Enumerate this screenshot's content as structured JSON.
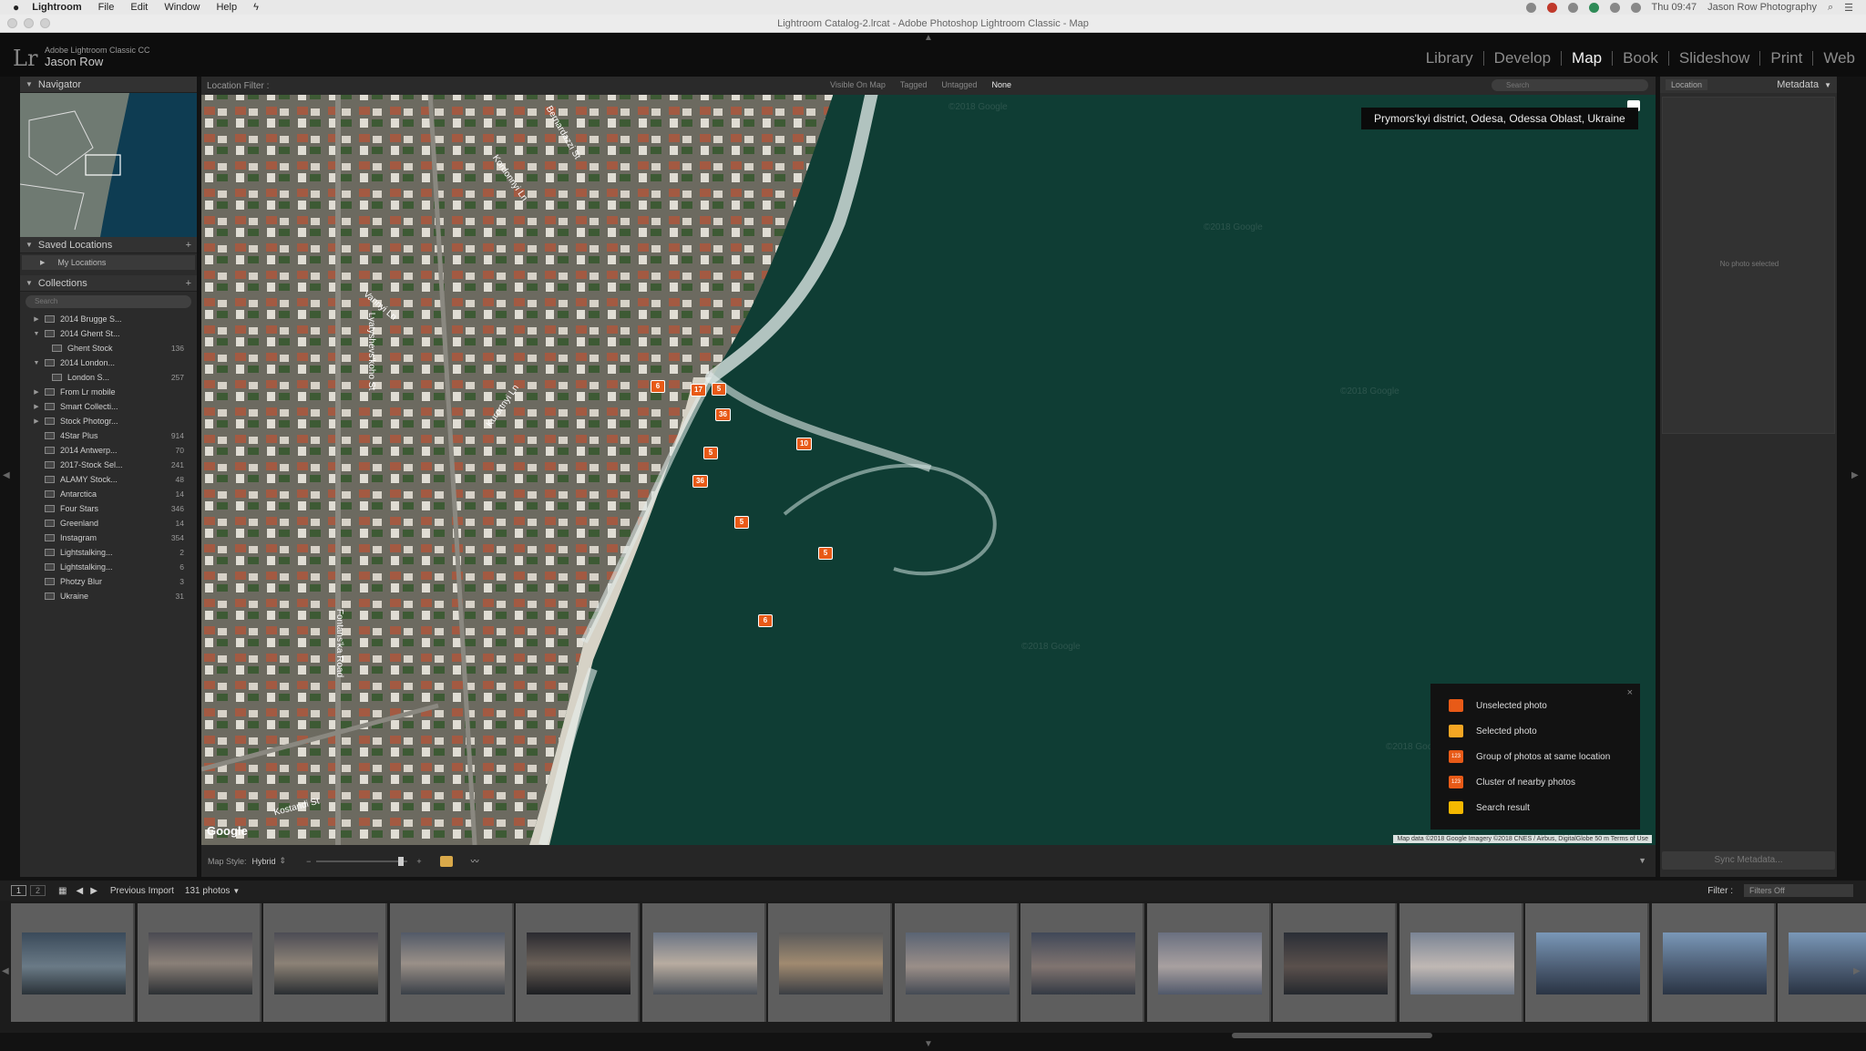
{
  "menubar": {
    "apple": "",
    "app": "Lightroom",
    "items": [
      "File",
      "Edit",
      "Window",
      "Help"
    ],
    "clock": "Thu 09:47",
    "user": "Jason Row Photography"
  },
  "window": {
    "title": "Lightroom Catalog-2.lrcat - Adobe Photoshop Lightroom Classic - Map"
  },
  "identity": {
    "logo": "Lr",
    "product": "Adobe Lightroom Classic CC",
    "user": "Jason Row"
  },
  "modules": [
    {
      "label": "Library",
      "active": false
    },
    {
      "label": "Develop",
      "active": false
    },
    {
      "label": "Map",
      "active": true
    },
    {
      "label": "Book",
      "active": false
    },
    {
      "label": "Slideshow",
      "active": false
    },
    {
      "label": "Print",
      "active": false
    },
    {
      "label": "Web",
      "active": false
    }
  ],
  "left_panel": {
    "navigator": "Navigator",
    "saved_locations": "Saved Locations",
    "my_locations": "My Locations",
    "collections": "Collections",
    "search_placeholder": "Search",
    "collection_items": [
      {
        "name": "2014 Brugge S...",
        "count": "",
        "twisty": "▶"
      },
      {
        "name": "2014 Ghent St...",
        "count": "",
        "twisty": "▼"
      },
      {
        "name": "Ghent Stock",
        "count": "136",
        "twisty": "",
        "indent": true
      },
      {
        "name": "2014 London...",
        "count": "",
        "twisty": "▼"
      },
      {
        "name": "London S...",
        "count": "257",
        "twisty": "",
        "indent": true
      },
      {
        "name": "From Lr mobile",
        "count": "",
        "twisty": "▶"
      },
      {
        "name": "Smart Collecti...",
        "count": "",
        "twisty": "▶"
      },
      {
        "name": "Stock Photogr...",
        "count": "",
        "twisty": "▶"
      },
      {
        "name": "4Star Plus",
        "count": "914",
        "twisty": ""
      },
      {
        "name": "2014 Antwerp...",
        "count": "70",
        "twisty": ""
      },
      {
        "name": "2017-Stock Sel...",
        "count": "241",
        "twisty": ""
      },
      {
        "name": "ALAMY Stock...",
        "count": "48",
        "twisty": ""
      },
      {
        "name": "Antarctica",
        "count": "14",
        "twisty": ""
      },
      {
        "name": "Four Stars",
        "count": "346",
        "twisty": ""
      },
      {
        "name": "Greenland",
        "count": "14",
        "twisty": ""
      },
      {
        "name": "Instagram",
        "count": "354",
        "twisty": ""
      },
      {
        "name": "Lightstalking...",
        "count": "2",
        "twisty": ""
      },
      {
        "name": "Lightstalking...",
        "count": "6",
        "twisty": ""
      },
      {
        "name": "Photzy Blur",
        "count": "3",
        "twisty": ""
      },
      {
        "name": "Ukraine",
        "count": "31",
        "twisty": ""
      }
    ]
  },
  "map": {
    "filter_label": "Location Filter :",
    "filter_options": [
      {
        "label": "Visible On Map",
        "active": false
      },
      {
        "label": "Tagged",
        "active": false
      },
      {
        "label": "Untagged",
        "active": false
      },
      {
        "label": "None",
        "active": true
      }
    ],
    "search_placeholder": "Search",
    "location_tooltip": "Prymors'kyi district, Odesa, Odessa Oblast, Ukraine",
    "pins": [
      "6",
      "17",
      "5",
      "36",
      "5",
      "10",
      "36",
      "5",
      "5",
      "6"
    ],
    "watermark": "©2018 Google",
    "google": "Google",
    "attribution": "Map data ©2018 Google Imagery ©2018 CNES / Airbus, DigitalGlobe   50 m   Terms of Use",
    "street_labels": [
      "Lyatyshevs'koho St",
      "Vannyi Ln",
      "Fontans'ka Road",
      "Kostandi St",
      "Bernardazzi St",
      "Kordonnyi Ln",
      "Kurortnyi Ln"
    ],
    "legend": {
      "close": "×",
      "items": [
        {
          "label": "Unselected photo",
          "color": "#e85a17",
          "num": ""
        },
        {
          "label": "Selected photo",
          "color": "#f5a623",
          "num": ""
        },
        {
          "label": "Group of photos at same location",
          "color": "#e85a17",
          "num": "123"
        },
        {
          "label": "Cluster of nearby photos",
          "color": "#e85a17",
          "num": "123"
        },
        {
          "label": "Search result",
          "color": "#f5b800",
          "num": ""
        }
      ]
    },
    "map_style_label": "Map Style:",
    "map_style_value": "Hybrid"
  },
  "right_panel": {
    "location": "Location",
    "metadata": "Metadata",
    "no_photo": "No photo selected",
    "sync": "Sync Metadata..."
  },
  "filmbar": {
    "page1": "1",
    "page2": "2",
    "source": "Previous Import",
    "count": "131 photos",
    "filter_label": "Filter :",
    "filter_value": "Filters Off"
  },
  "thumbnails": [
    {
      "bg": "linear-gradient(#3a4a5a,#6a7a86 55%,#2a3238)"
    },
    {
      "bg": "linear-gradient(#4a4a52,#8a8078 50%,#2c3034)"
    },
    {
      "bg": "linear-gradient(#4c4c54,#8c8276 50%,#2a2e32)"
    },
    {
      "bg": "linear-gradient(#525a68,#9a9088 50%,#3a4048)"
    },
    {
      "bg": "linear-gradient(#2a2a30,#6a6058 50%,#1c1e22)"
    },
    {
      "bg": "linear-gradient(#6a7484,#b8aca0 50%,#4a5058)"
    },
    {
      "bg": "linear-gradient(#5a5a5a,#a08a70 50%,#3a3e44)"
    },
    {
      "bg": "linear-gradient(#5a6474,#9a8e88 55%,#444a54)"
    },
    {
      "bg": "linear-gradient(#404858,#807470 55%,#343a44)"
    },
    {
      "bg": "linear-gradient(#6a7080,#a8a0a0 55%,#50586a)"
    },
    {
      "bg": "linear-gradient(#2a2e36,#5a504c 55%,#24282e)"
    },
    {
      "bg": "linear-gradient(#7a8494,#c0b8b4 55%,#6a7484)"
    },
    {
      "bg": "linear-gradient(#7a98b8,#4a5a70 60%,#2a3444)"
    },
    {
      "bg": "linear-gradient(#7a98b8,#4a5a70 60%,#2a3444)"
    },
    {
      "bg": "linear-gradient(#7a98b8,#4a5a70 60%,#2a3444)"
    }
  ]
}
